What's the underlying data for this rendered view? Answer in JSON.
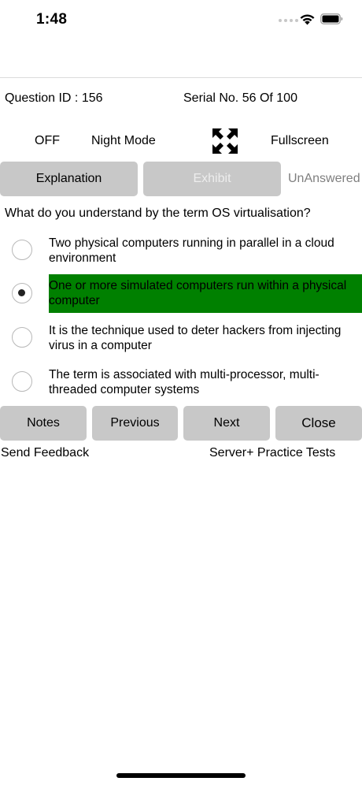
{
  "status_bar": {
    "time": "1:48"
  },
  "header": {
    "question_id": "Question ID : 156",
    "serial": "Serial No. 56 Of 100"
  },
  "mode_row": {
    "night_mode_state": "OFF",
    "night_mode_label": "Night Mode",
    "fullscreen_label": "Fullscreen"
  },
  "action_row": {
    "explanation_label": "Explanation",
    "exhibit_label": "Exhibit",
    "status": "UnAnswered"
  },
  "question": {
    "text": "What do you understand by the term OS virtualisation?",
    "options": [
      {
        "text": "Two physical computers running in parallel in a cloud environment",
        "selected": false
      },
      {
        "text": "One or more simulated computers run within a physical computer",
        "selected": true
      },
      {
        "text": "It is the technique used to deter hackers from injecting virus in a computer",
        "selected": false
      },
      {
        "text": "The term is associated with multi-processor, multi-threaded computer systems",
        "selected": false
      }
    ]
  },
  "nav_buttons": {
    "notes": "Notes",
    "previous": "Previous",
    "next": "Next",
    "close": "Close"
  },
  "footer": {
    "feedback": "Send Feedback",
    "app_name": "Server+ Practice Tests"
  },
  "colors": {
    "selected_option_bg": "#008000",
    "button_bg": "#c8c8c8",
    "disabled_text": "#ededed",
    "status_text": "#7f7f7f"
  }
}
